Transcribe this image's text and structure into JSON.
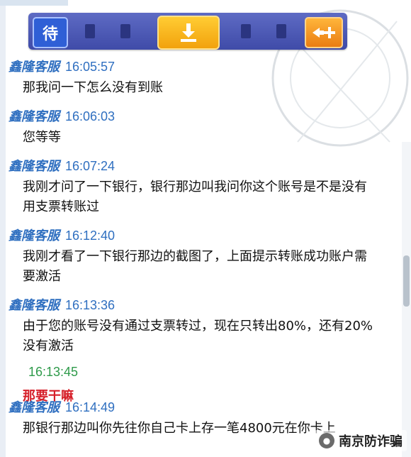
{
  "toolbar": {
    "left_button_label": "待"
  },
  "messages": [
    {
      "sender": "鑫隆客服",
      "time": "16:05:57",
      "text": "那我问一下怎么没有到账"
    },
    {
      "sender": "鑫隆客服",
      "time": "16:06:03",
      "text": "您等等"
    },
    {
      "sender": "鑫隆客服",
      "time": "16:07:24",
      "text": "我刚才问了一下银行，银行那边叫我问你这个账号是不是没有用支票转账过"
    },
    {
      "sender": "鑫隆客服",
      "time": "16:12:40",
      "text": "我刚才看了一下银行那边的截图了，上面提示转账成功账户需要激活"
    },
    {
      "sender": "鑫隆客服",
      "time": "16:13:36",
      "text": "由于您的账号没有通过支票转过，现在只转出80%，还有20%没有激活"
    }
  ],
  "self_message": {
    "time": "16:13:45",
    "text": "那要干嘛"
  },
  "last_message": {
    "sender": "鑫隆客服",
    "time": "16:14:49",
    "text": "那银行那边叫你先往你自己卡上存一笔4800元在你卡上"
  },
  "watermark": {
    "text": "南京防诈骗"
  },
  "colors": {
    "sender": "#2f6fc0",
    "self_time": "#2e9a4a",
    "self_text": "#d6202a"
  }
}
